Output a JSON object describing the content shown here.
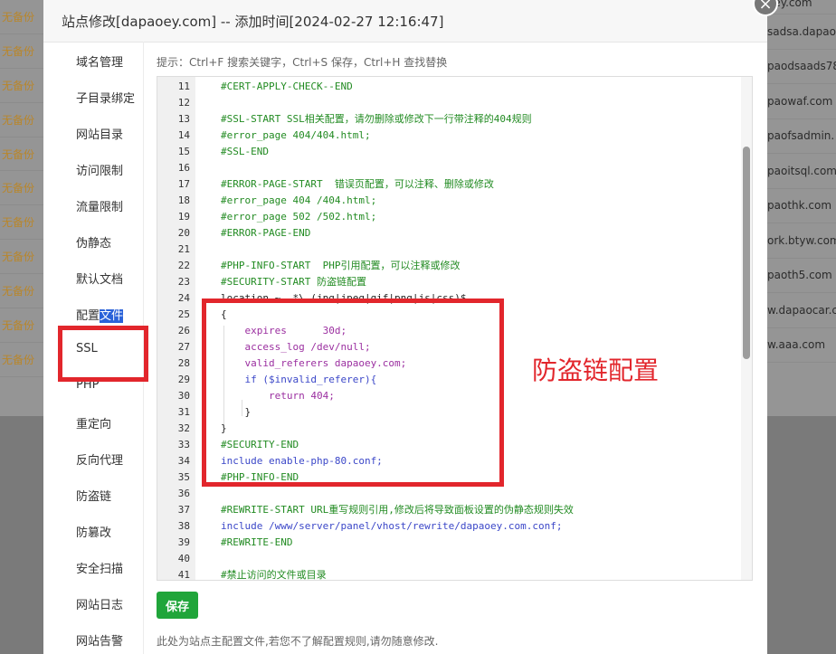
{
  "background": {
    "left_rows": [
      "无备份",
      "无备份",
      "无备份",
      "无备份",
      "无备份",
      "无备份",
      "无备份",
      "无备份",
      "无备份",
      "无备份",
      "无备份"
    ],
    "right_rows": [
      "oey.com",
      "sadsa.dapao.",
      "paodsaads78",
      "paowaf.com",
      "paofsadmin.",
      "paoitsql.com",
      "paothk.com",
      "ork.btyw.com",
      "paoth5.com",
      "w.dapaocar.c",
      "w.aaa.com"
    ]
  },
  "dialog": {
    "title": "站点修改[dapaoey.com] -- 添加时间[2024-02-27 12:16:47]",
    "close_icon": "×"
  },
  "sidebar": {
    "items": [
      "域名管理",
      "子目录绑定",
      "网站目录",
      "访问限制",
      "流量限制",
      "伪静态",
      "默认文档",
      "配置文件",
      "SSL",
      "PHP",
      "重定向",
      "反向代理",
      "防盗链",
      "防篡改",
      "安全扫描",
      "网站日志",
      "网站告警"
    ],
    "selected_prefix": "配置",
    "selected_highlight": "文件"
  },
  "editor": {
    "tip": "提示：Ctrl+F 搜索关键字，Ctrl+S 保存，Ctrl+H 查找替换",
    "lines": [
      {
        "n": "11",
        "text": "#CERT-APPLY-CHECK--END"
      },
      {
        "n": "12",
        "text": ""
      },
      {
        "n": "13",
        "text": "#SSL-START SSL相关配置，请勿删除或修改下一行带注释的404规则"
      },
      {
        "n": "14",
        "text": "#error_page 404/404.html;"
      },
      {
        "n": "15",
        "text": "#SSL-END"
      },
      {
        "n": "16",
        "text": ""
      },
      {
        "n": "17",
        "text": "#ERROR-PAGE-START  错误页配置，可以注释、删除或修改"
      },
      {
        "n": "18",
        "text": "#error_page 404 /404.html;"
      },
      {
        "n": "19",
        "text": "#error_page 502 /502.html;"
      },
      {
        "n": "20",
        "text": "#ERROR-PAGE-END"
      },
      {
        "n": "21",
        "text": ""
      },
      {
        "n": "22",
        "text": "#PHP-INFO-START  PHP引用配置，可以注释或修改"
      },
      {
        "n": "23",
        "text": "#SECURITY-START 防盗链配置"
      },
      {
        "n": "24",
        "text": "location ~ .*\\.(jpg|jpeg|gif|png|js|css)$"
      },
      {
        "n": "25",
        "text": "{"
      },
      {
        "n": "26",
        "text": "    expires      30d;"
      },
      {
        "n": "27",
        "text": "    access_log /dev/null;"
      },
      {
        "n": "28",
        "text": "    valid_referers dapaoey.com;"
      },
      {
        "n": "29",
        "text": "    if ($invalid_referer){"
      },
      {
        "n": "30",
        "text": "        return 404;"
      },
      {
        "n": "31",
        "text": "    }"
      },
      {
        "n": "32",
        "text": "}"
      },
      {
        "n": "33",
        "text": "#SECURITY-END"
      },
      {
        "n": "34",
        "text": "include enable-php-80.conf;"
      },
      {
        "n": "35",
        "text": "#PHP-INFO-END"
      },
      {
        "n": "36",
        "text": ""
      },
      {
        "n": "37",
        "text": "#REWRITE-START URL重写规则引用,修改后将导致面板设置的伪静态规则失效"
      },
      {
        "n": "38",
        "text": "include /www/server/panel/vhost/rewrite/dapaoey.com.conf;"
      },
      {
        "n": "39",
        "text": "#REWRITE-END"
      },
      {
        "n": "40",
        "text": ""
      },
      {
        "n": "41",
        "text": "#禁止访问的文件或目录"
      }
    ]
  },
  "annotation": {
    "label": "防盗链配置",
    "color": "#e2262c"
  },
  "footer": {
    "save_label": "保存",
    "note": "此处为站点主配置文件,若您不了解配置规则,请勿随意修改."
  }
}
